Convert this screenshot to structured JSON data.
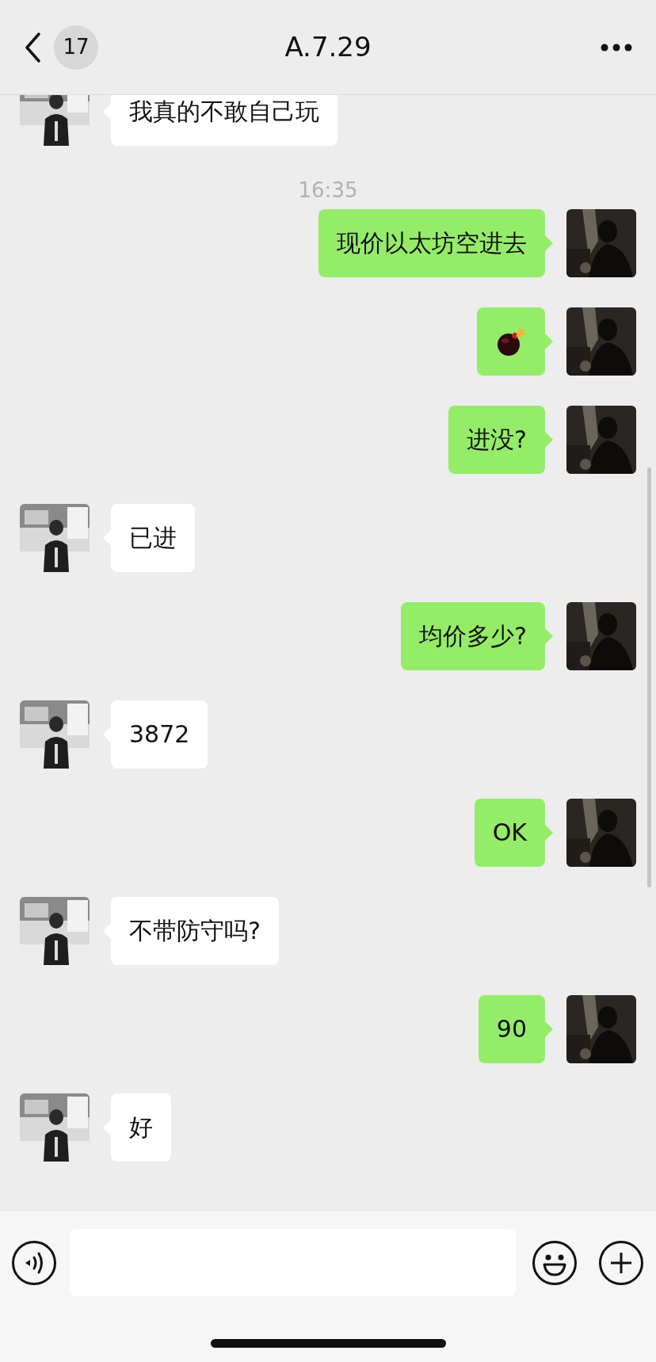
{
  "header": {
    "unread_count": "17",
    "title": "A.7.29"
  },
  "messages": [
    {
      "kind": "text",
      "outgoing": false,
      "text": "我真的不敢自己玩"
    },
    {
      "kind": "time",
      "text": "16:35"
    },
    {
      "kind": "text",
      "outgoing": true,
      "text": "现价以太坊空进去"
    },
    {
      "kind": "emoji",
      "outgoing": true
    },
    {
      "kind": "text",
      "outgoing": true,
      "text": "进没?"
    },
    {
      "kind": "text",
      "outgoing": false,
      "text": "已进"
    },
    {
      "kind": "text",
      "outgoing": true,
      "text": "均价多少?"
    },
    {
      "kind": "text",
      "outgoing": false,
      "text": "3872"
    },
    {
      "kind": "text",
      "outgoing": true,
      "text": "OK"
    },
    {
      "kind": "text",
      "outgoing": false,
      "text": "不带防守吗?"
    },
    {
      "kind": "text",
      "outgoing": true,
      "text": "90"
    },
    {
      "kind": "text",
      "outgoing": false,
      "text": "好"
    }
  ]
}
